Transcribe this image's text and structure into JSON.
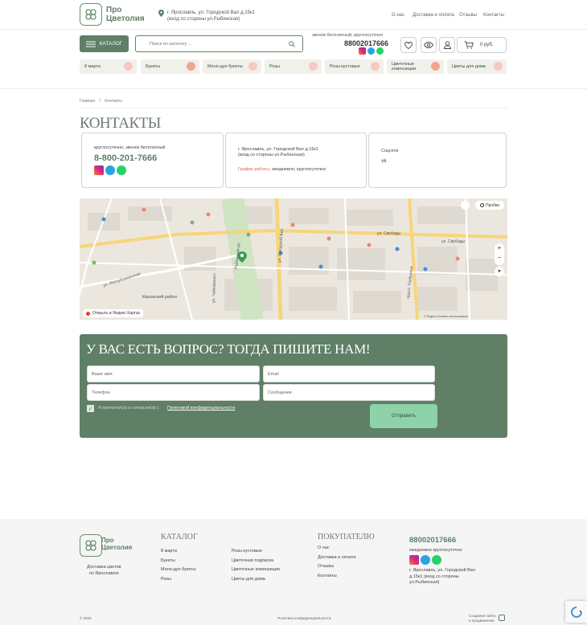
{
  "header": {
    "logo_line1": "Про",
    "logo_line2": "Цветолия",
    "address_line1": "г. Ярославль, ул. Городской Вал д.15к1",
    "address_line2": "(вход со стороны ул.Рыбинская)",
    "nav": [
      "О нас",
      "Доставка и оплата",
      "Отзывы",
      "Контакты"
    ],
    "catalog_label": "КАТАЛОГ",
    "search_placeholder": "Поиск по каталогу ...",
    "phone_note": "звонок бесплатный, круглосуточно",
    "phone": "88002017666",
    "cart_total": "0 руб."
  },
  "categories": [
    "8 марта",
    "Букеты",
    "Моно-дуо букеты",
    "Розы",
    "Розы кустовые",
    "Цветочные композиции",
    "Цветы для дома"
  ],
  "breadcrumb": {
    "home": "Главная",
    "sep": "/",
    "current": "Контакты"
  },
  "page_title": "КОНТАКТЫ",
  "contact_cards": {
    "phone_note": "круглосуточно, звонок бесплатный",
    "phone": "8-800-201-7666",
    "address_line1": "г. Ярославль, ул. Городской Вал д.15к1",
    "address_line2": "(вход со стороны ул.Рыбинская)",
    "schedule_label": "График работы:",
    "schedule_value": "ежедневно, круглосуточно",
    "social_label": "Соцсети"
  },
  "map": {
    "traffic_label": "Пробки",
    "open_label": "Открыть в Яндекс Картах",
    "streets": [
      "ул. Свободы",
      "ул. Свободы",
      "ул. Городской Вал",
      "просп. Толбухина",
      "Рыбинская ул.",
      "ул. Чайковского",
      "Кировский район",
      "ул. Республиканская"
    ],
    "footer_text": "© Яндекс  Условия использования"
  },
  "form": {
    "title": "У ВАС ЕСТЬ ВОПРОС? ТОГДА ПИШИТЕ НАМ!",
    "name_placeholder": "Ваше имя",
    "email_placeholder": "Email",
    "phone_placeholder": "Телефон",
    "message_placeholder": "Сообщение",
    "agree_text": "Я прочитал(а) и согласен(а) с",
    "agree_link": "Политикой конфиденциальности",
    "submit_label": "Отправить"
  },
  "footer": {
    "logo_line1": "Про",
    "logo_line2": "Цветолия",
    "tagline_line1": "Доставка цветов",
    "tagline_line2": "по Ярославлю",
    "catalog_title": "КАТАЛОГ",
    "catalog_col1": [
      "8 марта",
      "Букеты",
      "Моно-дуо букеты",
      "Розы"
    ],
    "catalog_col2": [
      "Розы кустовые",
      "Цветочная подписка",
      "Цветочные композиции",
      "Цветы для дома"
    ],
    "buyers_title": "ПОКУПАТЕЛЮ",
    "buyers_links": [
      "О нас",
      "Доставка и оплата",
      "Отзывы",
      "Контакты"
    ],
    "phone": "88002017666",
    "schedule": "ежедневно круглосуточно",
    "address": [
      "г. Ярославль, ул. Городской Вал",
      "д.15к1 (вход со стороны",
      "ул.Рыбинская)"
    ],
    "copyright": "© 2025",
    "privacy": "Политика конфиденциальности",
    "dev_line1": "Создание сайта",
    "dev_line2": "и продвижение"
  }
}
